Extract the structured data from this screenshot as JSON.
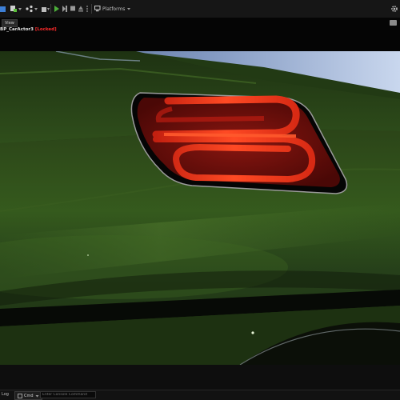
{
  "toolbar": {
    "platforms_label": "Platforms"
  },
  "viewport": {
    "view_tab_label": "View",
    "actor_label": "BP_CarActor3",
    "actor_status": "[Locked]"
  },
  "statusbar": {
    "log_label": "Log",
    "cmd_label": "Cmd",
    "cmd_placeholder": "Enter Console Command"
  },
  "colors": {
    "paint_green": "#2e4a1a",
    "taillight_red": "#ff3a1a",
    "locked_red": "#ff2a2a",
    "play_green": "#4caf3a"
  }
}
